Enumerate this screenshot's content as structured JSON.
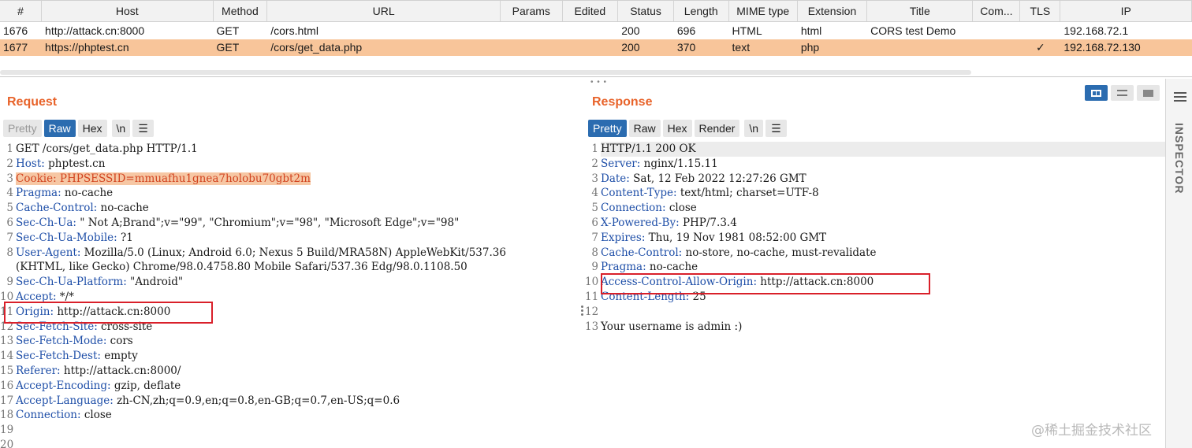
{
  "history": {
    "columns": [
      "#",
      "Host",
      "Method",
      "URL",
      "Params",
      "Edited",
      "Status",
      "Length",
      "MIME type",
      "Extension",
      "Title",
      "Com...",
      "TLS",
      "IP"
    ],
    "rows": [
      {
        "num": "1676",
        "host": "http://attack.cn:8000",
        "method": "GET",
        "url": "/cors.html",
        "params": "",
        "edited": "",
        "status": "200",
        "length": "696",
        "mime": "HTML",
        "ext": "html",
        "title": "CORS test Demo",
        "comment": "",
        "tls": "",
        "ip": "192.168.72.1"
      },
      {
        "num": "1677",
        "host": "https://phptest.cn",
        "method": "GET",
        "url": "/cors/get_data.php",
        "params": "",
        "edited": "",
        "status": "200",
        "length": "370",
        "mime": "text",
        "ext": "php",
        "title": "",
        "comment": "",
        "tls": "✓",
        "ip": "192.168.72.130"
      }
    ]
  },
  "request": {
    "title": "Request",
    "tabs": [
      "Pretty",
      "Raw",
      "Hex",
      "\\n"
    ],
    "lines": [
      {
        "n": "1",
        "text": "GET /cors/get_data.php HTTP/1.1"
      },
      {
        "n": "2",
        "key": "Host",
        "val": " phptest.cn"
      },
      {
        "n": "3",
        "key": "Cookie",
        "val": " PHPSESSID=mmuafhu1gnea7holobu70gbt2m"
      },
      {
        "n": "4",
        "key": "Pragma",
        "val": " no-cache"
      },
      {
        "n": "5",
        "key": "Cache-Control",
        "val": " no-cache"
      },
      {
        "n": "6",
        "key": "Sec-Ch-Ua",
        "val": " \" Not A;Brand\";v=\"99\", \"Chromium\";v=\"98\", \"Microsoft Edge\";v=\"98\""
      },
      {
        "n": "7",
        "key": "Sec-Ch-Ua-Mobile",
        "val": " ?1"
      },
      {
        "n": "8",
        "key": "User-Agent",
        "val": " Mozilla/5.0 (Linux; Android 6.0; Nexus 5 Build/MRA58N) AppleWebKit/537.36"
      },
      {
        "n": "",
        "text": "(KHTML, like Gecko) Chrome/98.0.4758.80 Mobile Safari/537.36 Edg/98.0.1108.50"
      },
      {
        "n": "9",
        "key": "Sec-Ch-Ua-Platform",
        "val": " \"Android\""
      },
      {
        "n": "10",
        "key": "Accept",
        "val": " */*"
      },
      {
        "n": "11",
        "key": "Origin",
        "val": " http://attack.cn:8000"
      },
      {
        "n": "12",
        "key": "Sec-Fetch-Site",
        "val": " cross-site"
      },
      {
        "n": "13",
        "key": "Sec-Fetch-Mode",
        "val": " cors"
      },
      {
        "n": "14",
        "key": "Sec-Fetch-Dest",
        "val": " empty"
      },
      {
        "n": "15",
        "key": "Referer",
        "val": " http://attack.cn:8000/"
      },
      {
        "n": "16",
        "key": "Accept-Encoding",
        "val": " gzip, deflate"
      },
      {
        "n": "17",
        "key": "Accept-Language",
        "val": " zh-CN,zh;q=0.9,en;q=0.8,en-GB;q=0.7,en-US;q=0.6"
      },
      {
        "n": "18",
        "key": "Connection",
        "val": " close"
      },
      {
        "n": "19",
        "text": ""
      },
      {
        "n": "20",
        "text": ""
      }
    ]
  },
  "response": {
    "title": "Response",
    "tabs": [
      "Pretty",
      "Raw",
      "Hex",
      "Render",
      "\\n"
    ],
    "lines": [
      {
        "n": "1",
        "text": "HTTP/1.1 200 OK"
      },
      {
        "n": "2",
        "key": "Server",
        "val": " nginx/1.15.11"
      },
      {
        "n": "3",
        "key": "Date",
        "val": " Sat, 12 Feb 2022 12:27:26 GMT"
      },
      {
        "n": "4",
        "key": "Content-Type",
        "val": " text/html; charset=UTF-8"
      },
      {
        "n": "5",
        "key": "Connection",
        "val": " close"
      },
      {
        "n": "6",
        "key": "X-Powered-By",
        "val": " PHP/7.3.4"
      },
      {
        "n": "7",
        "key": "Expires",
        "val": " Thu, 19 Nov 1981 08:52:00 GMT"
      },
      {
        "n": "8",
        "key": "Cache-Control",
        "val": " no-store, no-cache, must-revalidate"
      },
      {
        "n": "9",
        "key": "Pragma",
        "val": " no-cache"
      },
      {
        "n": "10",
        "key": "Access-Control-Allow-Origin",
        "val": " http://attack.cn:8000"
      },
      {
        "n": "11",
        "key": "Content-Length",
        "val": " 25"
      },
      {
        "n": "12",
        "text": ""
      },
      {
        "n": "13",
        "text": "Your username is admin :)"
      }
    ]
  },
  "inspector": {
    "label": "INSPECTOR"
  },
  "watermark": "@稀土掘金技术社区",
  "colors": {
    "accent_orange": "#e8632a",
    "tab_active": "#2b6cb0",
    "selected_row": "#f8c59a",
    "highlight_box": "#d9202a",
    "header_key": "#1f4fa8"
  }
}
